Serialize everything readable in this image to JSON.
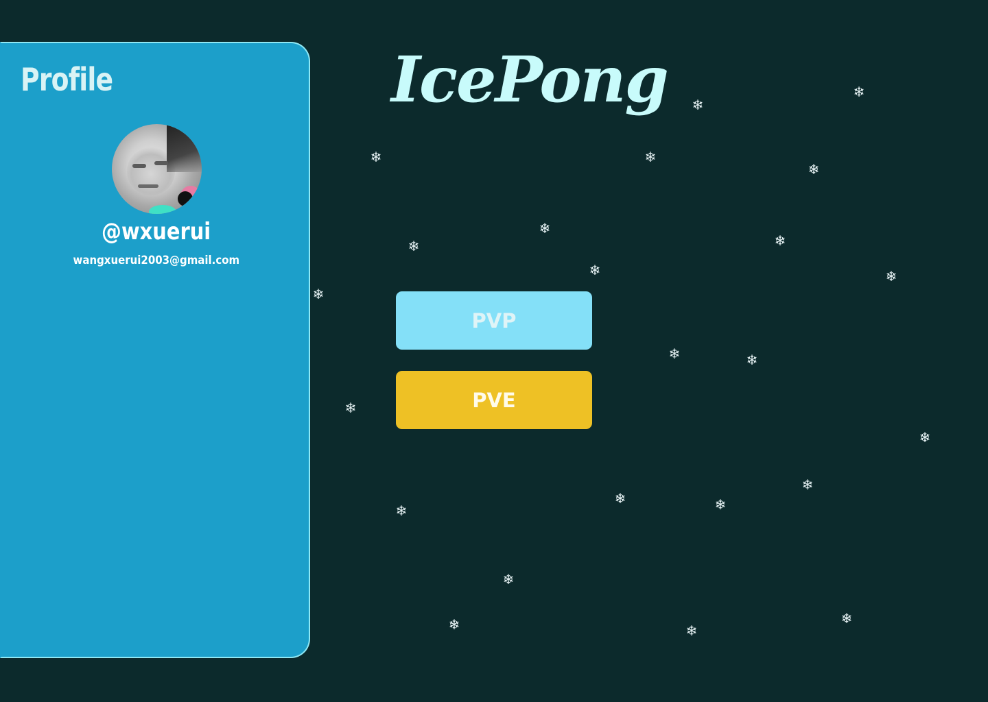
{
  "app": {
    "title": "IcePong"
  },
  "profile": {
    "heading": "Profile",
    "username": "@wxuerui",
    "email": "wangxuerui2003@gmail.com"
  },
  "modes": {
    "pvp_label": "PVP",
    "pve_label": "PVE"
  },
  "colors": {
    "background": "#0c2a2c",
    "panel": "#1c9fca",
    "panel_border": "#8fe8f5",
    "title": "#c8fbfb",
    "pvp": "#84e0f8",
    "pve": "#eec125"
  },
  "decorations": {
    "snowflake_glyph": "❄"
  }
}
